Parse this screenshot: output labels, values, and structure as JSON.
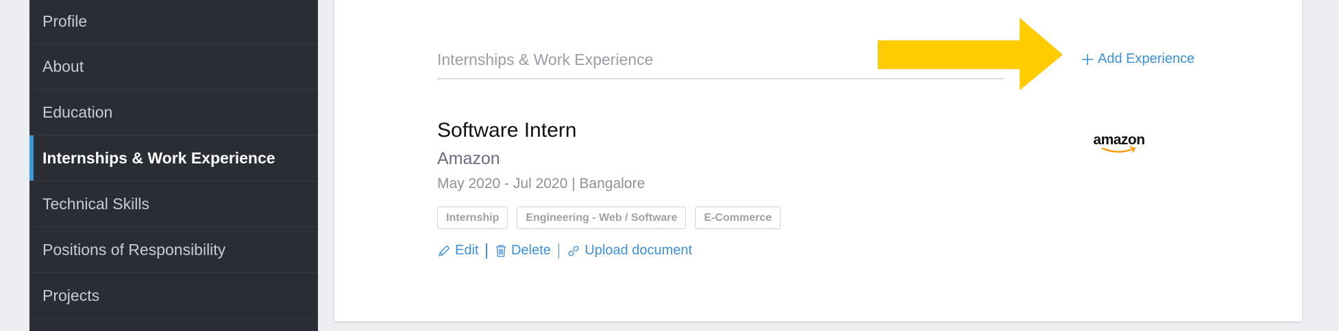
{
  "sidebar": {
    "items": [
      {
        "label": "Profile",
        "active": false
      },
      {
        "label": "About",
        "active": false
      },
      {
        "label": "Education",
        "active": false
      },
      {
        "label": "Internships & Work Experience",
        "active": true
      },
      {
        "label": "Technical Skills",
        "active": false
      },
      {
        "label": "Positions of Responsibility",
        "active": false
      },
      {
        "label": "Projects",
        "active": false
      }
    ]
  },
  "section": {
    "title": "Internships & Work Experience",
    "add_label": "Add Experience",
    "add_icon": "plus-icon"
  },
  "experience": {
    "title": "Software Intern",
    "company": "Amazon",
    "meta": "May 2020 - Jul 2020 | Bangalore",
    "tags": [
      "Internship",
      "Engineering - Web / Software",
      "E-Commerce"
    ],
    "logo_text": "amazon",
    "actions": {
      "edit": "Edit",
      "delete": "Delete",
      "upload": "Upload document"
    }
  },
  "colors": {
    "accent": "#3d8fd8",
    "arrow": "#ffcc00",
    "active_indicator": "#3a9ad9",
    "logo_smile": "#ff9900"
  }
}
